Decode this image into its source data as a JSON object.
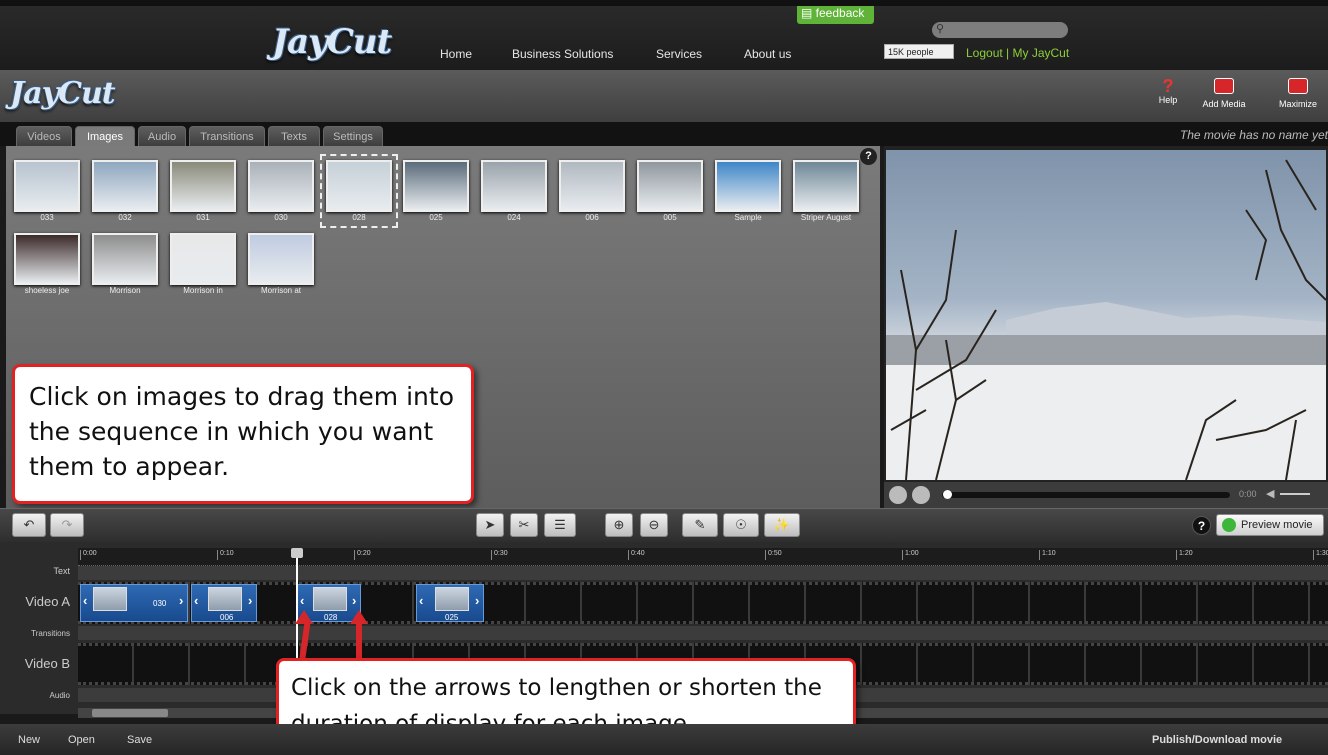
{
  "site": {
    "logo": "JayCut",
    "nav": [
      "Home",
      "Business Solutions",
      "Services",
      "About us"
    ],
    "feedback": "feedback",
    "like": "15K people",
    "account_links": "Logout | My JayCut"
  },
  "app": {
    "logo": "JayCut",
    "tools": [
      {
        "label": "Help",
        "icon": "help-icon"
      },
      {
        "label": "Add Media",
        "icon": "add-media-icon"
      },
      {
        "label": "Maximize",
        "icon": "maximize-icon"
      }
    ],
    "tabs": [
      "Videos",
      "Images",
      "Audio",
      "Transitions",
      "Texts",
      "Settings"
    ],
    "active_tab": "Images",
    "movie_name": "The movie has no name yet"
  },
  "images": [
    {
      "label": "033",
      "color": "#b7c3cf"
    },
    {
      "label": "032",
      "color": "#8fa7bf"
    },
    {
      "label": "031",
      "color": "#8a8a7a"
    },
    {
      "label": "030",
      "color": "#a9b1b8"
    },
    {
      "label": "028",
      "color": "#c6d0d8"
    },
    {
      "label": "025",
      "color": "#5a6b7a"
    },
    {
      "label": "024",
      "color": "#9aa3ab"
    },
    {
      "label": "006",
      "color": "#b0b8c0"
    },
    {
      "label": "005",
      "color": "#8f979e"
    },
    {
      "label": "Sample",
      "color": "#3f86c8"
    },
    {
      "label": "Striper August",
      "color": "#6f8797"
    },
    {
      "label": "shoeless joe",
      "color": "#3c2a2a"
    },
    {
      "label": "Morrison",
      "color": "#8d8d8d"
    },
    {
      "label": "Morrison in",
      "color": "#e8e8e8"
    },
    {
      "label": "Morrison at",
      "color": "#bfcbe0"
    }
  ],
  "callouts": {
    "top": "Click on images to drag them into the sequence in which you want them to appear.",
    "bottom": "Click on the arrows to lengthen or shorten the duration of display for each image."
  },
  "player": {
    "time": "0:00"
  },
  "toolbar": {
    "preview_label": "Preview movie"
  },
  "timeline": {
    "ticks": [
      "0:00",
      "0:10",
      "0:20",
      "0:30",
      "0:40",
      "0:50",
      "1:00",
      "1:10",
      "1:20",
      "1:30"
    ],
    "rows": [
      "Text",
      "Video A",
      "Transitions",
      "Video B",
      "Audio"
    ],
    "clips": [
      "030",
      "006",
      "028",
      "025"
    ]
  },
  "bottom": {
    "buttons": [
      "New",
      "Open",
      "Save"
    ],
    "publish": "Publish/Download movie"
  }
}
